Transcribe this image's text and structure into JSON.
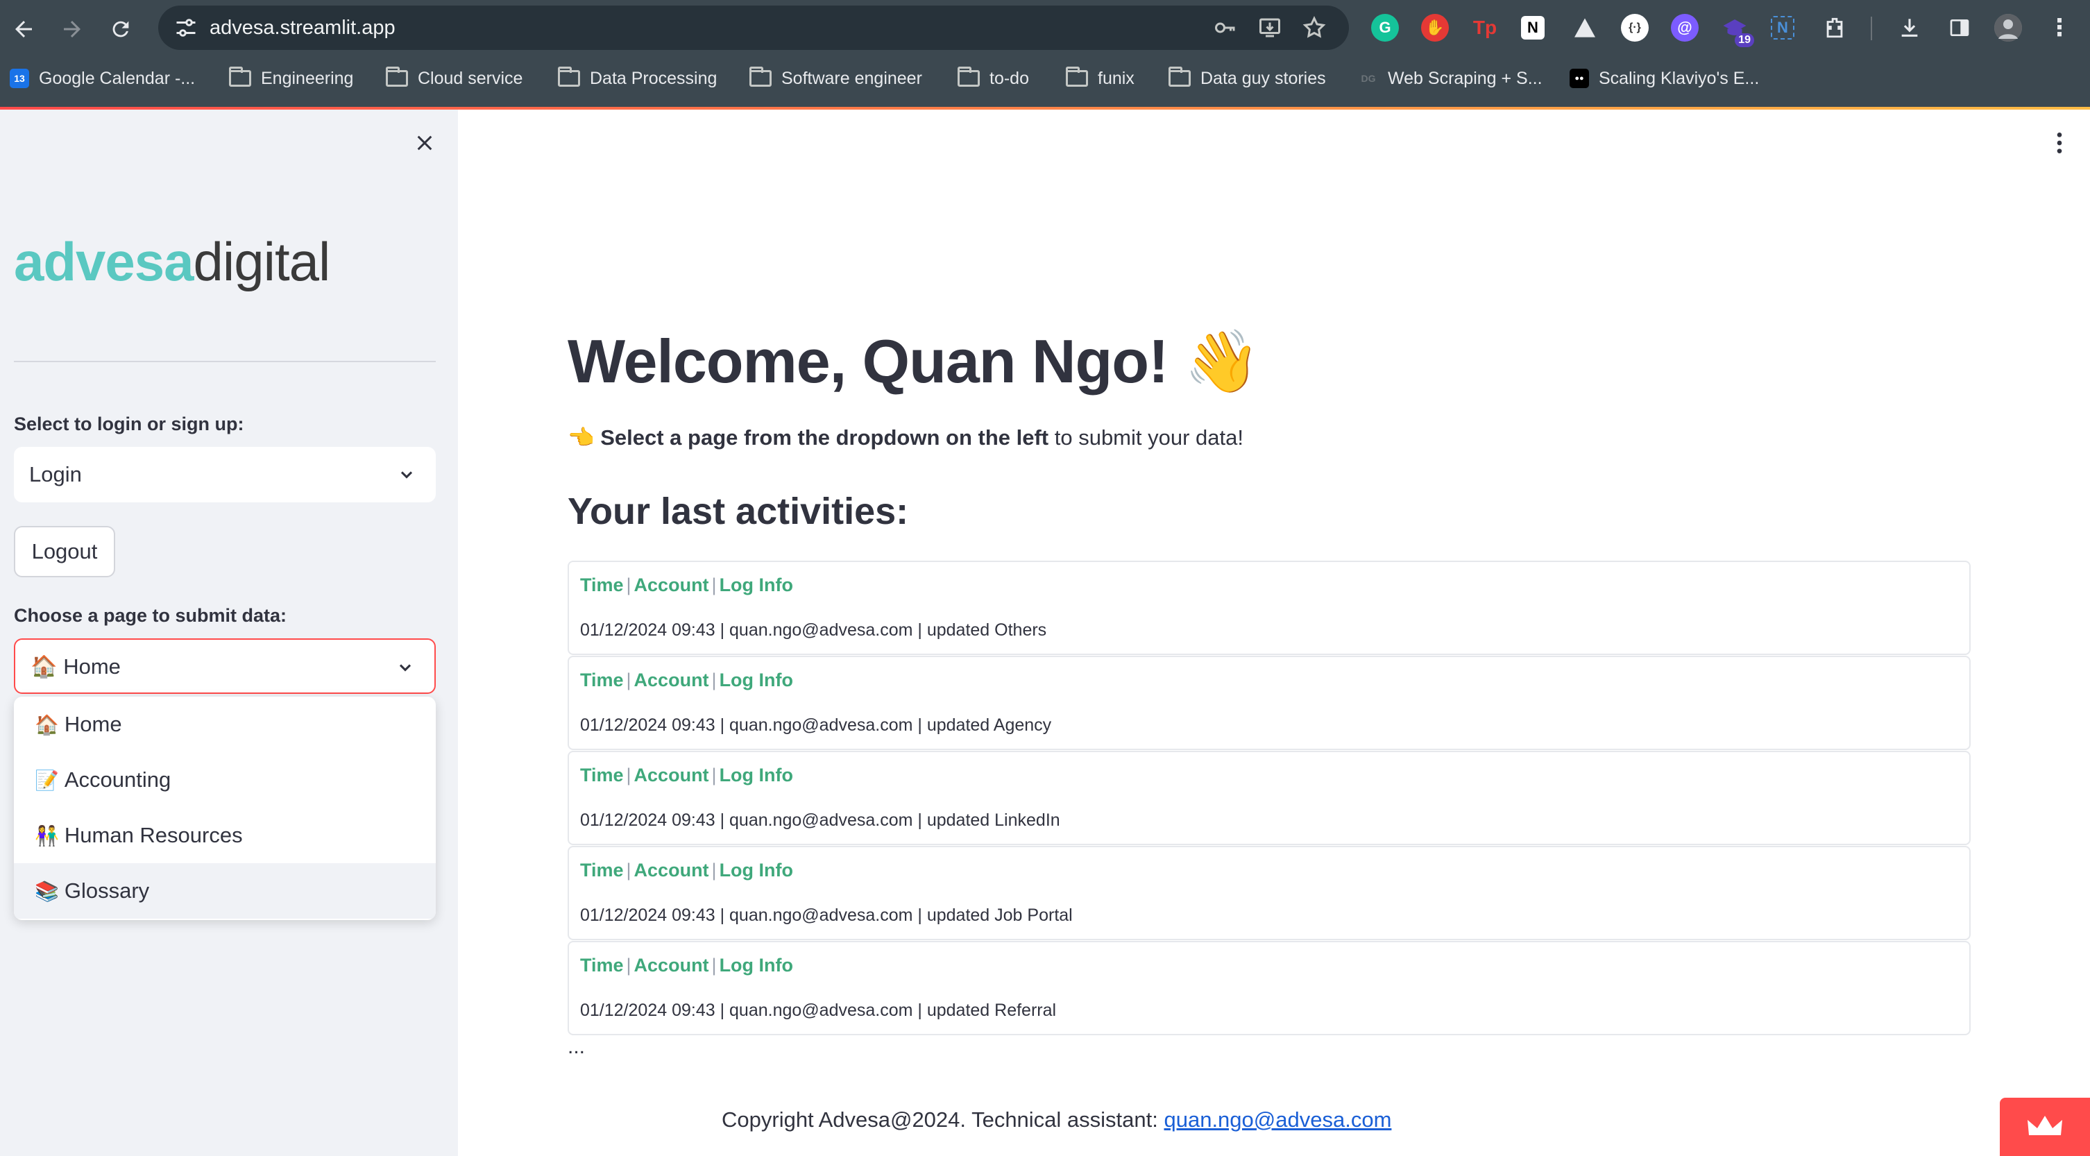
{
  "browser": {
    "url": "advesa.streamlit.app",
    "extension_badge": "19",
    "bookmarks": [
      {
        "label": "Google Calendar -...",
        "icon": "calendar-icon",
        "fav_text": "13"
      },
      {
        "label": "Engineering",
        "icon": "folder-icon"
      },
      {
        "label": "Cloud service",
        "icon": "folder-icon"
      },
      {
        "label": "Data Processing",
        "icon": "folder-icon"
      },
      {
        "label": "Software engineer",
        "icon": "folder-icon"
      },
      {
        "label": "to-do",
        "icon": "folder-icon"
      },
      {
        "label": "funix",
        "icon": "folder-icon"
      },
      {
        "label": "Data guy stories",
        "icon": "folder-icon"
      },
      {
        "label": "Web Scraping + S...",
        "icon": "dg-icon",
        "fav_text": "DG"
      },
      {
        "label": "Scaling Klaviyo's E...",
        "icon": "medium-icon",
        "fav_text": "●●"
      }
    ]
  },
  "sidebar": {
    "logo": {
      "part1": "advesa",
      "part2": "digital"
    },
    "auth_label": "Select to login or sign up:",
    "auth_value": "Login",
    "logout_label": "Logout",
    "page_label": "Choose a page to submit data:",
    "page_value": "🏠 Home",
    "page_options": [
      {
        "emoji": "🏠",
        "label": "Home"
      },
      {
        "emoji": "📝",
        "label": "Accounting"
      },
      {
        "emoji": "👫",
        "label": "Human Resources"
      },
      {
        "emoji": "📚",
        "label": "Glossary"
      }
    ]
  },
  "main": {
    "welcome": "Welcome, Quan Ngo! 👋",
    "hint": {
      "emoji": "👈",
      "bold": "Select a page from the dropdown on the left",
      "rest": " to submit your data!"
    },
    "activities_title": "Your last activities:",
    "activity_header": {
      "time": "Time",
      "account": "Account",
      "log": "Log Info",
      "sep": "|"
    },
    "activities": [
      "01/12/2024 09:43 | quan.ngo@advesa.com | updated Others",
      "01/12/2024 09:43 | quan.ngo@advesa.com | updated Agency",
      "01/12/2024 09:43 | quan.ngo@advesa.com | updated LinkedIn",
      "01/12/2024 09:43 | quan.ngo@advesa.com | updated Job Portal",
      "01/12/2024 09:43 | quan.ngo@advesa.com | updated Referral"
    ],
    "ellipsis": "...",
    "footer_text": "Copyright Advesa@2024. Technical assistant: ",
    "footer_link": "quan.ngo@advesa.com"
  },
  "colors": {
    "accent": "#ff4b4b",
    "sidebar_bg": "#f0f2f6",
    "activity_header": "#3fa87b",
    "logo_teal": "#5ac8c1",
    "chrome_bg": "#3c4850"
  }
}
